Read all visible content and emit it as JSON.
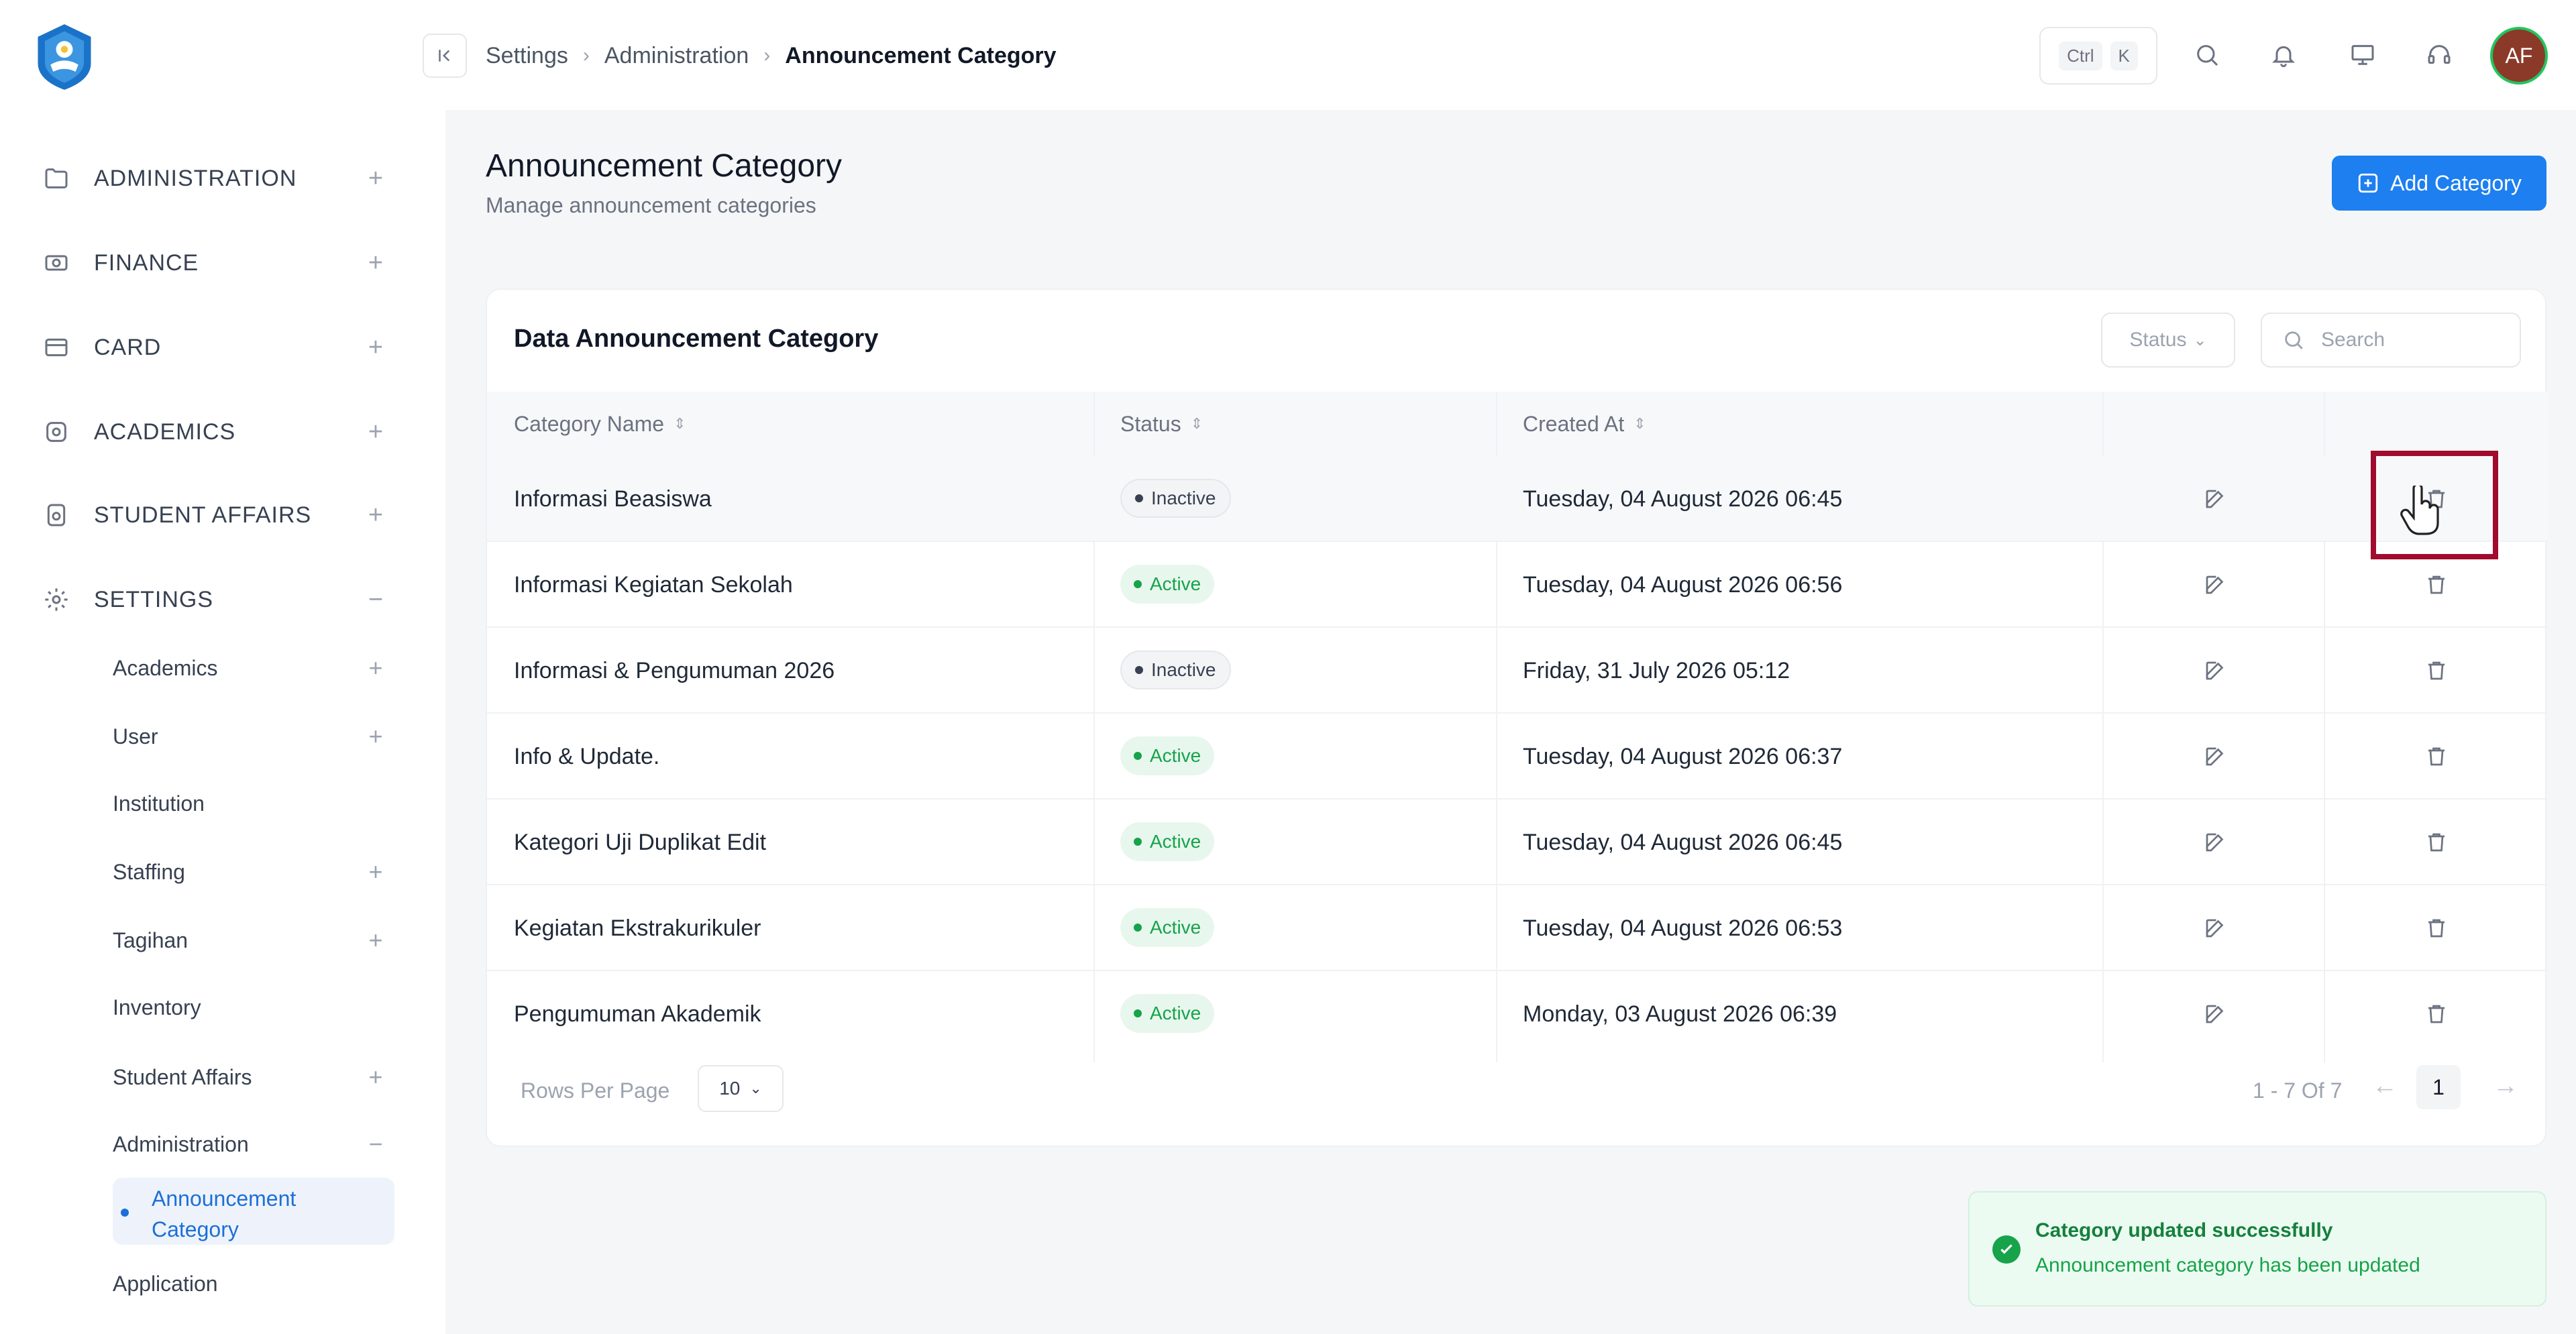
{
  "breadcrumb": [
    "Settings",
    "Administration",
    "Announcement Category"
  ],
  "shortcut": {
    "key1": "Ctrl",
    "key2": "K"
  },
  "user": {
    "initials": "AF"
  },
  "sidebar": {
    "top_items": [
      {
        "label": "ADMINISTRATION",
        "toggle": "+"
      },
      {
        "label": "FINANCE",
        "toggle": "+"
      },
      {
        "label": "CARD",
        "toggle": "+"
      },
      {
        "label": "ACADEMICS",
        "toggle": "+"
      },
      {
        "label": "STUDENT AFFAIRS",
        "toggle": "+"
      },
      {
        "label": "SETTINGS",
        "toggle": "−"
      }
    ],
    "settings_items": [
      {
        "label": "Academics",
        "toggle": "+"
      },
      {
        "label": "User",
        "toggle": "+"
      },
      {
        "label": "Institution",
        "toggle": ""
      },
      {
        "label": "Staffing",
        "toggle": "+"
      },
      {
        "label": "Tagihan",
        "toggle": "+"
      },
      {
        "label": "Inventory",
        "toggle": ""
      },
      {
        "label": "Student Affairs",
        "toggle": "+"
      },
      {
        "label": "Administration",
        "toggle": "−"
      }
    ],
    "active_item": "Announcement Category",
    "after_item": "Application"
  },
  "page": {
    "title": "Announcement Category",
    "subtitle": "Manage announcement categories",
    "add_button": "Add Category"
  },
  "table": {
    "title": "Data Announcement Category",
    "status_filter": "Status",
    "search_placeholder": "Search",
    "columns": [
      "Category Name",
      "Status",
      "Created At"
    ],
    "rows": [
      {
        "name": "Informasi Beasiswa",
        "status": "Inactive",
        "created": "Tuesday, 04 August 2026 06:45"
      },
      {
        "name": "Informasi Kegiatan Sekolah",
        "status": "Active",
        "created": "Tuesday, 04 August 2026 06:56"
      },
      {
        "name": "Informasi & Pengumuman 2026",
        "status": "Inactive",
        "created": "Friday, 31 July 2026 05:12"
      },
      {
        "name": "Info & Update.",
        "status": "Active",
        "created": "Tuesday, 04 August 2026 06:37"
      },
      {
        "name": "Kategori Uji Duplikat Edit",
        "status": "Active",
        "created": "Tuesday, 04 August 2026 06:45"
      },
      {
        "name": "Kegiatan Ekstrakurikuler",
        "status": "Active",
        "created": "Tuesday, 04 August 2026 06:53"
      },
      {
        "name": "Pengumuman Akademik",
        "status": "Active",
        "created": "Monday, 03 August 2026 06:39"
      }
    ],
    "rows_per_page_label": "Rows Per Page",
    "rows_per_page": "10",
    "range": "1 - 7 Of 7",
    "current_page": "1"
  },
  "toast": {
    "title": "Category updated successfully",
    "message": "Announcement category has been updated"
  },
  "colors": {
    "primary": "#1d7ff0",
    "active_green": "#16a34a",
    "highlight": "#a10b2e"
  }
}
